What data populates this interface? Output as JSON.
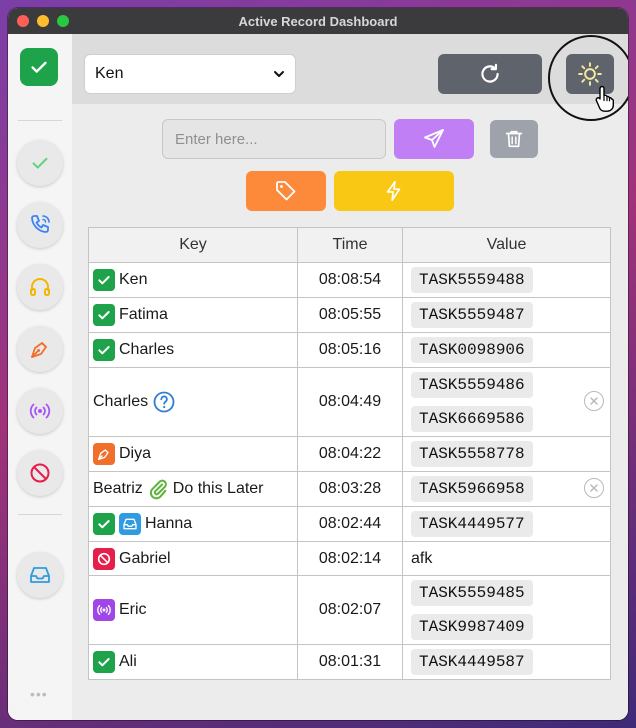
{
  "window": {
    "title": "Active Record Dashboard"
  },
  "toolbar": {
    "selected_user": "Ken",
    "user_options": [
      "Ken"
    ]
  },
  "input": {
    "placeholder": "Enter here...",
    "value": ""
  },
  "table": {
    "headers": {
      "key": "Key",
      "time": "Time",
      "value": "Value"
    },
    "rows": [
      {
        "key": "Ken",
        "time": "08:08:54",
        "values": [
          "TASK5559488"
        ],
        "icons": [
          "check-icon"
        ]
      },
      {
        "key": "Fatima",
        "time": "08:05:55",
        "values": [
          "TASK5559487"
        ],
        "icons": [
          "check-icon"
        ]
      },
      {
        "key": "Charles",
        "time": "08:05:16",
        "values": [
          "TASK0098906"
        ],
        "icons": [
          "check-icon"
        ]
      },
      {
        "key": "Charles",
        "time": "08:04:49",
        "values": [
          "TASK5559486",
          "TASK6669586"
        ],
        "icons": [
          "question-icon"
        ]
      },
      {
        "key": "Diya",
        "time": "08:04:22",
        "values": [
          "TASK5558778"
        ],
        "icons": [
          "pen-icon"
        ]
      },
      {
        "key": "Beatriz",
        "note": "Do this Later",
        "time": "08:03:28",
        "values": [
          "TASK5966958"
        ],
        "icons": [
          "paperclip-icon"
        ]
      },
      {
        "key": "Hanna",
        "time": "08:02:44",
        "values": [
          "TASK4449577"
        ],
        "icons": [
          "check-icon",
          "inbox-icon"
        ]
      },
      {
        "key": "Gabriel",
        "time": "08:02:14",
        "values": [
          "afk"
        ],
        "icons": [
          "ban-icon"
        ]
      },
      {
        "key": "Eric",
        "time": "08:02:07",
        "values": [
          "TASK5559485",
          "TASK9987409"
        ],
        "icons": [
          "broadcast-icon"
        ]
      },
      {
        "key": "Ali",
        "time": "08:01:31",
        "values": [
          "TASK4449587"
        ],
        "icons": [
          "check-icon"
        ]
      }
    ]
  },
  "colors": {
    "green": "#1fa34a",
    "orange": "#fd8a3b",
    "yellow": "#f9c814",
    "purple": "#c07ff5",
    "red": "#e51e4a",
    "blue": "#2f9be0",
    "dark_button": "#5f636b"
  }
}
